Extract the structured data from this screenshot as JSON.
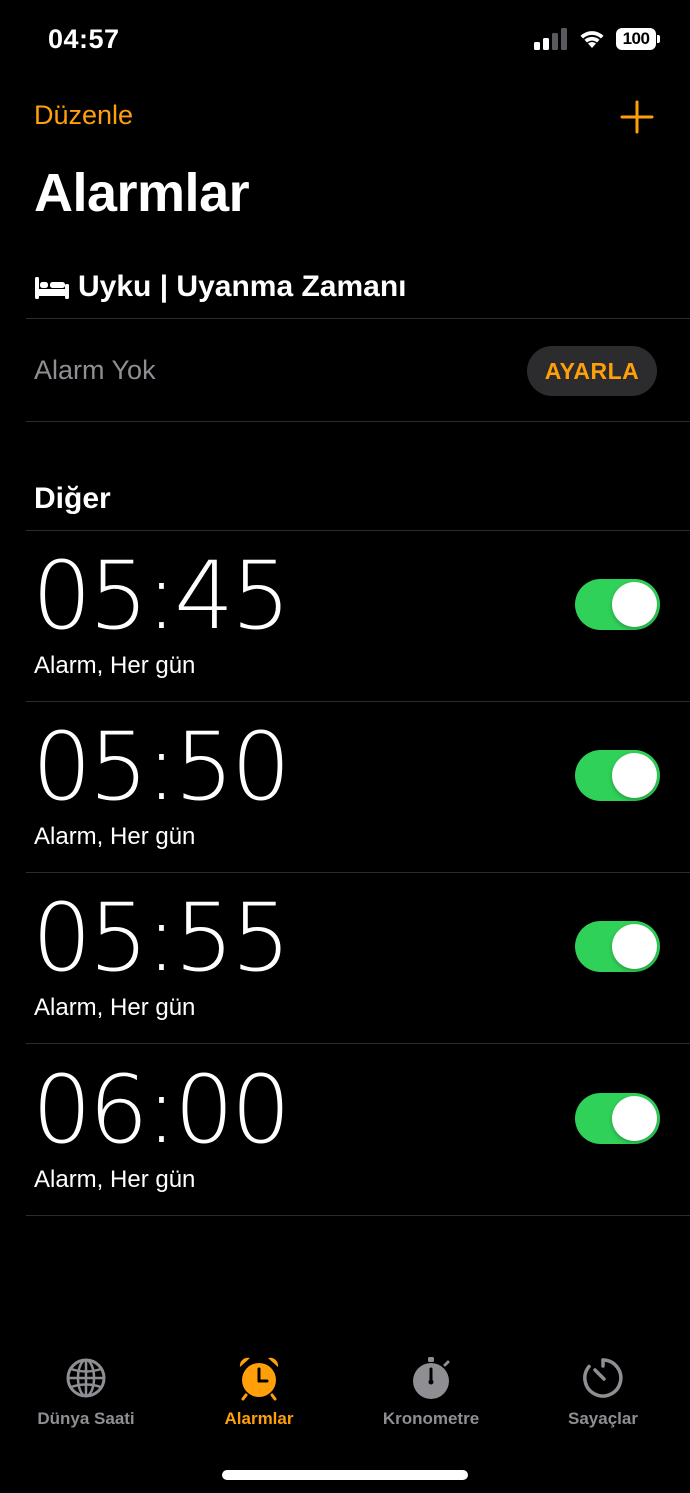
{
  "status_bar": {
    "time": "04:57",
    "battery": "100"
  },
  "nav": {
    "edit_label": "Düzenle",
    "add_icon": "plus-icon"
  },
  "title": "Alarmlar",
  "sleep": {
    "icon": "bed-icon",
    "header": "Uyku | Uyanma Zamanı",
    "no_alarm": "Alarm Yok",
    "setup_label": "AYARLA"
  },
  "other_header": "Diğer",
  "alarms": [
    {
      "time": "05:45",
      "label": "Alarm, Her gün",
      "enabled": true
    },
    {
      "time": "05:50",
      "label": "Alarm, Her gün",
      "enabled": true
    },
    {
      "time": "05:55",
      "label": "Alarm, Her gün",
      "enabled": true
    },
    {
      "time": "06:00",
      "label": "Alarm, Her gün",
      "enabled": true
    }
  ],
  "tabs": [
    {
      "label": "Dünya Saati",
      "icon": "globe-icon",
      "active": false
    },
    {
      "label": "Alarmlar",
      "icon": "alarm-clock-icon",
      "active": true
    },
    {
      "label": "Kronometre",
      "icon": "stopwatch-icon",
      "active": false
    },
    {
      "label": "Sayaçlar",
      "icon": "timer-icon",
      "active": false
    }
  ],
  "colors": {
    "accent": "#ff9f0a",
    "toggle_on": "#30d158",
    "secondary_text": "#8e8e93",
    "separator": "#2c2c2e",
    "background": "#000000"
  }
}
